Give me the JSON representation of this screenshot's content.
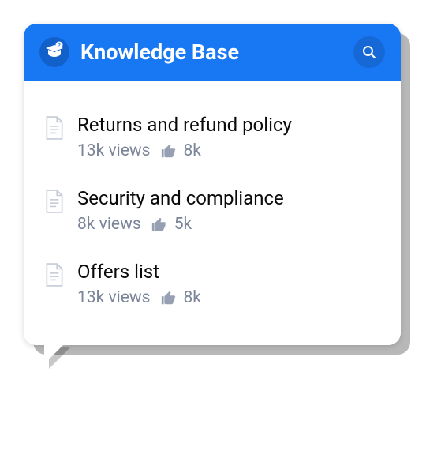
{
  "header": {
    "title": "Knowledge Base"
  },
  "articles": [
    {
      "title": "Returns and refund policy",
      "views": "13k views",
      "likes": "8k"
    },
    {
      "title": "Security and compliance",
      "views": "8k views",
      "likes": "5k"
    },
    {
      "title": "Offers list",
      "views": "13k views",
      "likes": "8k"
    }
  ]
}
